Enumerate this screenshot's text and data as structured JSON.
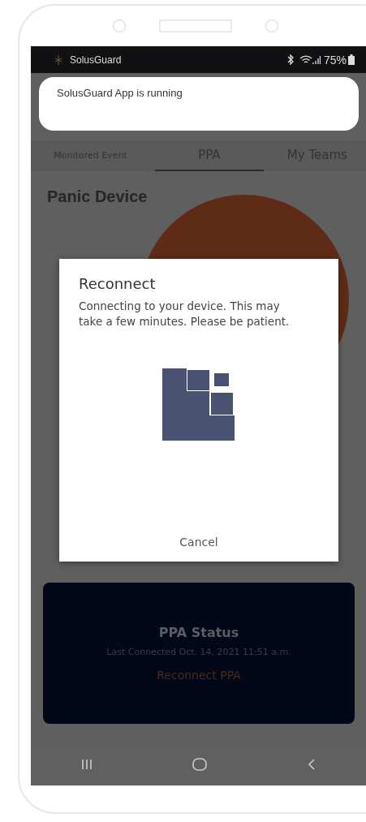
{
  "status_bar": {
    "app_name": "SolusGuard",
    "battery": "75%"
  },
  "notification": {
    "text": "SolusGuard App is running"
  },
  "tabs": [
    {
      "label": "Monitored Event",
      "selected": false
    },
    {
      "label": "PPA",
      "selected": true
    },
    {
      "label": "My Teams",
      "selected": false
    }
  ],
  "section_title": "Panic Device",
  "dialog": {
    "title": "Reconnect",
    "message": "Connecting to your device. This may take a few minutes. Please be patient.",
    "button": "Cancel"
  },
  "status_card": {
    "title": "PPA Status",
    "subtitle": "Last Connected Oct. 14, 2021 11:51 a.m.",
    "action": "Reconnect PPA"
  },
  "nav_bar": [
    {
      "kind": "recents"
    },
    {
      "kind": "home"
    },
    {
      "kind": "back"
    }
  ]
}
